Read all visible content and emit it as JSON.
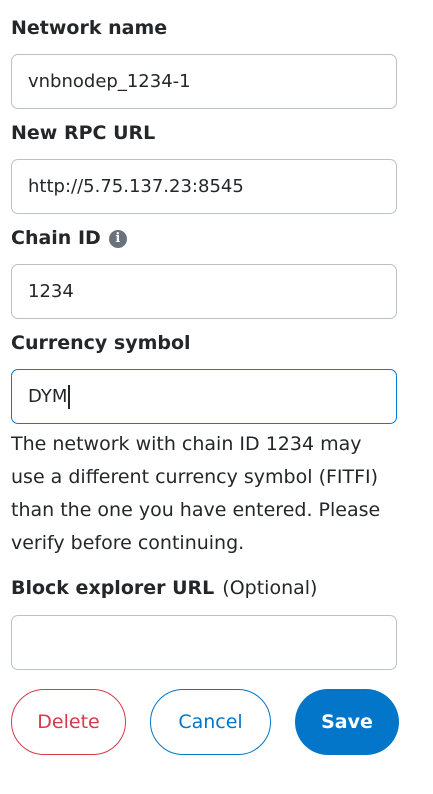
{
  "network_name": {
    "label": "Network name",
    "value": "vnbnodep_1234-1"
  },
  "rpc_url": {
    "label": "New RPC URL",
    "value": "http://5.75.137.23:8545"
  },
  "chain_id": {
    "label": "Chain ID",
    "info_icon": "i",
    "value": "1234"
  },
  "currency_symbol": {
    "label": "Currency symbol",
    "value": "DYM",
    "warning": "The network with chain ID 1234 may use a different currency symbol (FITFI) than the one you have entered. Please verify before continuing."
  },
  "block_explorer": {
    "label": "Block explorer URL",
    "optional": "(Optional)",
    "value": ""
  },
  "buttons": {
    "delete": "Delete",
    "cancel": "Cancel",
    "save": "Save"
  },
  "colors": {
    "primary": "#0376c9",
    "danger": "#d73a49",
    "border": "#bbc0c5",
    "text": "#24272a"
  }
}
